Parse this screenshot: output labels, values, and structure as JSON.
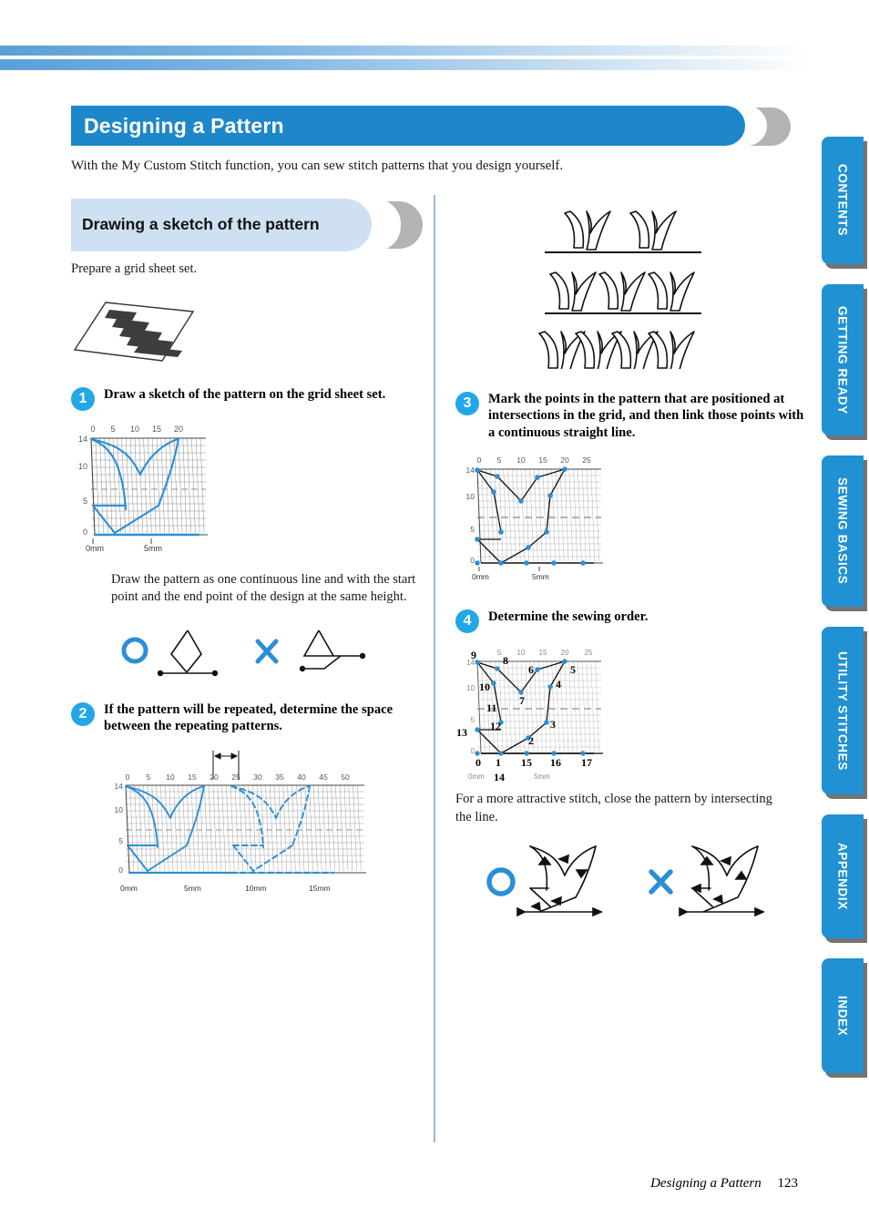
{
  "document": {
    "chapter_title": "Designing a Pattern",
    "intro": "With the My Custom Stitch function, you can sew stitch patterns that you design yourself."
  },
  "section": {
    "heading": "Drawing a sketch of the pattern",
    "lead_text": "Prepare a grid sheet set."
  },
  "steps": [
    {
      "number": "1",
      "text": "Draw a sketch of the pattern on the grid sheet set.",
      "note": "Draw the pattern as one continuous line and with the start point and the end point of the design at the same height."
    },
    {
      "number": "2",
      "text": "If the pattern will be repeated, determine the space between the repeating patterns."
    },
    {
      "number": "3",
      "text": "Mark the points in the pattern that are positioned at intersections in the grid, and then link those points with a continuous straight line."
    },
    {
      "number": "4",
      "text": "Determine the sewing order.",
      "note": "For a more attractive stitch, close the pattern by intersecting the line."
    }
  ],
  "figures": {
    "grid_sheet_caption": "grid-sheet-illustration",
    "ok_mark": "O",
    "ng_mark": "X"
  },
  "chart_data": [
    {
      "id": "step1-grid",
      "type": "line",
      "title": "",
      "xlabel": "",
      "ylabel": "",
      "x_ticks": [
        "0",
        "5",
        "10",
        "15",
        "20"
      ],
      "y_ticks": [
        "0",
        "5",
        "10",
        "14"
      ],
      "mm_labels": [
        "0mm",
        "5mm"
      ],
      "xlim": [
        0,
        23
      ],
      "ylim": [
        0,
        14
      ],
      "grid": true,
      "series": [
        {
          "name": "sketch-curve",
          "points": [
            [
              0,
              3
            ],
            [
              7,
              3
            ],
            [
              7,
              14
            ],
            [
              0,
              14
            ],
            [
              0,
              14
            ],
            [
              11.5,
              10.2
            ],
            [
              19,
              14
            ],
            [
              19,
              14
            ],
            [
              15,
              5
            ],
            [
              11.5,
              10.2
            ]
          ]
        }
      ]
    },
    {
      "id": "step2-grid",
      "type": "line",
      "title": "",
      "x_ticks": [
        "0",
        "5",
        "10",
        "15",
        "20",
        "25",
        "30",
        "35",
        "40",
        "45",
        "50"
      ],
      "y_ticks": [
        "0",
        "5",
        "10",
        "14"
      ],
      "mm_labels": [
        "0mm",
        "5mm",
        "10mm",
        "15mm"
      ],
      "xlim": [
        0,
        52
      ],
      "ylim": [
        0,
        14
      ],
      "grid": true,
      "annotation": "space-between-repeats-bracket",
      "series": [
        {
          "name": "pattern-solid",
          "points": [
            [
              0,
              3
            ],
            [
              7,
              3
            ],
            [
              7,
              14
            ],
            [
              0,
              14
            ],
            [
              11.5,
              10.2
            ],
            [
              19,
              14
            ],
            [
              15,
              5
            ],
            [
              11.5,
              10.2
            ]
          ]
        },
        {
          "name": "pattern-dashed-repeat",
          "points": [
            [
              23,
              3
            ],
            [
              30,
              3
            ],
            [
              30,
              14
            ],
            [
              23,
              14
            ],
            [
              34.5,
              10.2
            ],
            [
              42,
              14
            ],
            [
              38,
              5
            ],
            [
              34.5,
              10.2
            ]
          ]
        }
      ]
    },
    {
      "id": "step3-grid",
      "type": "scatter",
      "title": "",
      "x_ticks": [
        "0",
        "5",
        "10",
        "15",
        "20",
        "25"
      ],
      "y_ticks": [
        "0",
        "5",
        "10",
        "14"
      ],
      "mm_labels": [
        "0mm",
        "5mm"
      ],
      "xlim": [
        0,
        26
      ],
      "ylim": [
        0,
        14
      ],
      "grid": true,
      "marker_color": "#2b8fd6",
      "points": [
        [
          0,
          14
        ],
        [
          7,
          13
        ],
        [
          11.5,
          10.2
        ],
        [
          14,
          13
        ],
        [
          19,
          14
        ],
        [
          15,
          11
        ],
        [
          15,
          5
        ],
        [
          11.5,
          2
        ],
        [
          7,
          0
        ],
        [
          12,
          0
        ],
        [
          17,
          0
        ],
        [
          22,
          0
        ],
        [
          4,
          12
        ],
        [
          7,
          3
        ],
        [
          0,
          3
        ],
        [
          0,
          0
        ]
      ]
    },
    {
      "id": "step4-grid",
      "type": "scatter",
      "title": "",
      "x_ticks": [
        "5",
        "10",
        "15",
        "20",
        "25"
      ],
      "y_ticks": [
        "0",
        "5",
        "10",
        "14"
      ],
      "mm_labels": [
        "0mm",
        "5mm"
      ],
      "xlim": [
        0,
        26
      ],
      "ylim": [
        0,
        14
      ],
      "grid": true,
      "marker_color": "#2b8fd6",
      "sewing_order_labels": [
        "1",
        "2",
        "3",
        "4",
        "5",
        "6",
        "7",
        "8",
        "9",
        "10",
        "11",
        "12",
        "13",
        "14",
        "15",
        "16",
        "17"
      ],
      "labeled_points": [
        {
          "label": "1",
          "x": 7,
          "y": 0
        },
        {
          "label": "2",
          "x": 11.5,
          "y": 2
        },
        {
          "label": "3",
          "x": 15,
          "y": 5
        },
        {
          "label": "4",
          "x": 15.5,
          "y": 11
        },
        {
          "label": "5",
          "x": 19,
          "y": 14
        },
        {
          "label": "6",
          "x": 14,
          "y": 13
        },
        {
          "label": "7",
          "x": 11.5,
          "y": 10.2
        },
        {
          "label": "8",
          "x": 7,
          "y": 13
        },
        {
          "label": "9",
          "x": 0,
          "y": 14
        },
        {
          "label": "10",
          "x": 4,
          "y": 12
        },
        {
          "label": "11",
          "x": 6,
          "y": 7.5
        },
        {
          "label": "12",
          "x": 7,
          "y": 3
        },
        {
          "label": "13",
          "x": 0,
          "y": 3
        },
        {
          "label": "14",
          "x": 0,
          "y": 0
        },
        {
          "label": "15",
          "x": 12,
          "y": 0
        },
        {
          "label": "16",
          "x": 17,
          "y": 0
        },
        {
          "label": "17",
          "x": 22,
          "y": 0
        }
      ]
    }
  ],
  "tabs": [
    {
      "label": "CONTENTS"
    },
    {
      "label": "GETTING READY"
    },
    {
      "label": "SEWING BASICS"
    },
    {
      "label": "UTILITY STITCHES"
    },
    {
      "label": "APPENDIX"
    },
    {
      "label": "INDEX"
    }
  ],
  "footer": {
    "chapter": "Designing a Pattern",
    "page": "123"
  },
  "colors": {
    "title_blue": "#1e87c9",
    "step_blue": "#22a7e8",
    "section_blue": "#cfe0f3",
    "tab_blue": "#2091d2",
    "grid_line": "#2b8fd6"
  }
}
